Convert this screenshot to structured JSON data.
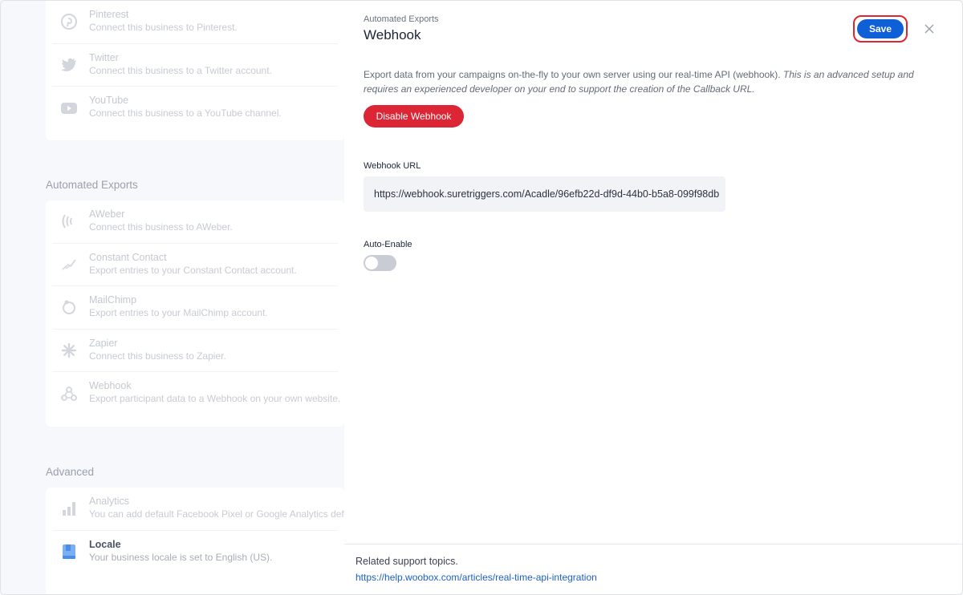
{
  "left": {
    "social": [
      {
        "title": "Pinterest",
        "desc": "Connect this business to Pinterest.",
        "icon": "pinterest-icon"
      },
      {
        "title": "Twitter",
        "desc": "Connect this business to a Twitter account.",
        "icon": "twitter-icon"
      },
      {
        "title": "YouTube",
        "desc": "Connect this business to a YouTube channel.",
        "icon": "youtube-icon"
      }
    ],
    "exports_title": "Automated Exports",
    "exports": [
      {
        "title": "AWeber",
        "desc": "Connect this business to AWeber.",
        "icon": "aweber-icon"
      },
      {
        "title": "Constant Contact",
        "desc": "Export entries to your Constant Contact account.",
        "icon": "constant-contact-icon"
      },
      {
        "title": "MailChimp",
        "desc": "Export entries to your MailChimp account.",
        "icon": "mailchimp-icon"
      },
      {
        "title": "Zapier",
        "desc": "Connect this business to Zapier.",
        "icon": "zapier-icon"
      },
      {
        "title": "Webhook",
        "desc": "Export participant data to a Webhook on your own website.",
        "icon": "webhook-icon"
      }
    ],
    "advanced_title": "Advanced",
    "advanced": [
      {
        "title": "Analytics",
        "desc": "You can add default Facebook Pixel or Google Analytics default",
        "icon": "analytics-icon"
      },
      {
        "title": "Locale",
        "desc": "Your business locale is set to English (US).",
        "icon": "book-icon"
      }
    ]
  },
  "panel": {
    "breadcrumb": "Automated Exports",
    "title": "Webhook",
    "save_label": "Save",
    "description_plain": "Export data from your campaigns on-the-fly to your own server using our real-time API (webhook).",
    "description_italic": "This is an advanced setup and requires an experienced developer on your end to support the creation of the Callback URL.",
    "disable_label": "Disable Webhook",
    "url_label": "Webhook URL",
    "url_value": "https://webhook.suretriggers.com/Acadle/96efb22d-df9d-44b0-b5a8-099f98db",
    "auto_enable_label": "Auto-Enable",
    "auto_enable_on": false
  },
  "footer": {
    "title": "Related support topics.",
    "link": "https://help.woobox.com/articles/real-time-api-integration"
  },
  "colors": {
    "save": "#0f5fd7",
    "disable": "#dc2636",
    "focus_ring": "#e0252f",
    "link": "#1f5fc4"
  }
}
